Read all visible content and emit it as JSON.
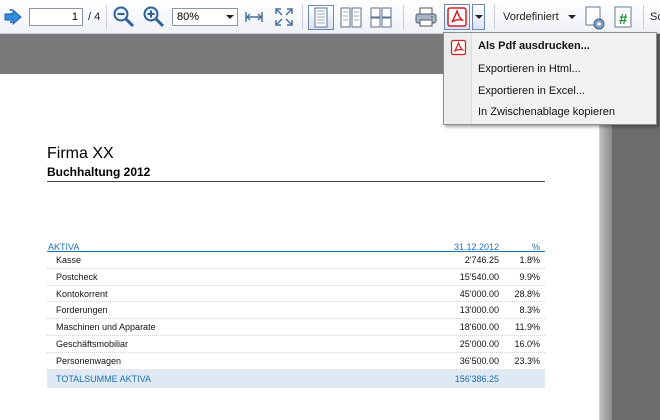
{
  "toolbar": {
    "page_current": "1",
    "page_total": "/ 4",
    "zoom_value": "80%",
    "preset_label": "Vordefiniert",
    "edge_label": "Sc"
  },
  "export_menu": {
    "items": [
      {
        "label": "Als Pdf ausdrucken...",
        "icon": "pdf-icon"
      },
      {
        "label": "Exportieren in Html..."
      },
      {
        "label": "Exportieren in Excel..."
      },
      {
        "label": "In Zwischenablage kopieren"
      }
    ]
  },
  "document": {
    "company": "Firma XX",
    "subtitle": "Buchhaltung 2012",
    "table": {
      "header": {
        "label": "AKTIVA",
        "date": "31.12.2012",
        "pct": "%"
      },
      "rows": [
        {
          "label": "Kasse",
          "value": "2'746.25",
          "pct": "1.8%"
        },
        {
          "label": "Postcheck",
          "value": "15'540.00",
          "pct": "9.9%"
        },
        {
          "label": "Kontokorrent",
          "value": "45'000.00",
          "pct": "28.8%"
        },
        {
          "label": "Forderungen",
          "value": "13'000.00",
          "pct": "8.3%"
        },
        {
          "label": "Maschinen und Apparate",
          "value": "18'600.00",
          "pct": "11.9%"
        },
        {
          "label": "Geschäftsmobiliar",
          "value": "25'000.00",
          "pct": "16.0%"
        },
        {
          "label": "Personenwagen",
          "value": "36'500.00",
          "pct": "23.3%"
        }
      ],
      "total": {
        "label": "TOTALSUMME AKTIVA",
        "value": "156'386.25"
      }
    }
  },
  "colors": {
    "accent_blue": "#1e6fb0",
    "pdf_red": "#d22020",
    "excel_green": "#1f8a2e"
  }
}
